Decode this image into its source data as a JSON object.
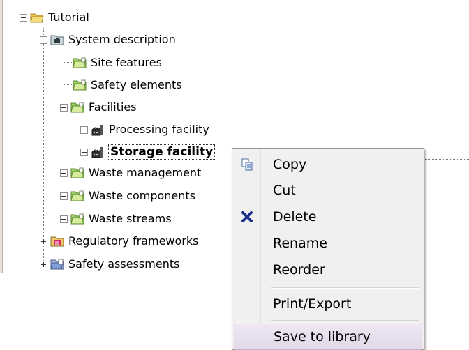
{
  "tree": {
    "root": "Tutorial",
    "system_description": "System description",
    "site_features": "Site features",
    "safety_elements": "Safety elements",
    "facilities": "Facilities",
    "processing_facility": "Processing facility",
    "storage_facility": "Storage facility",
    "waste_management": "Waste management",
    "waste_components": "Waste components",
    "waste_streams": "Waste streams",
    "regulatory_frameworks": "Regulatory frameworks",
    "safety_assessments": "Safety assessments"
  },
  "context_menu": {
    "copy": "Copy",
    "cut": "Cut",
    "delete": "Delete",
    "rename": "Rename",
    "reorder": "Reorder",
    "print_export": "Print/Export",
    "save_to_library": "Save to library"
  },
  "colors": {
    "folder_yellow": "#e8c64a",
    "folder_green": "#9ccc65",
    "delete_blue": "#1c2f8a",
    "menu_hover": "#e4dbec"
  }
}
